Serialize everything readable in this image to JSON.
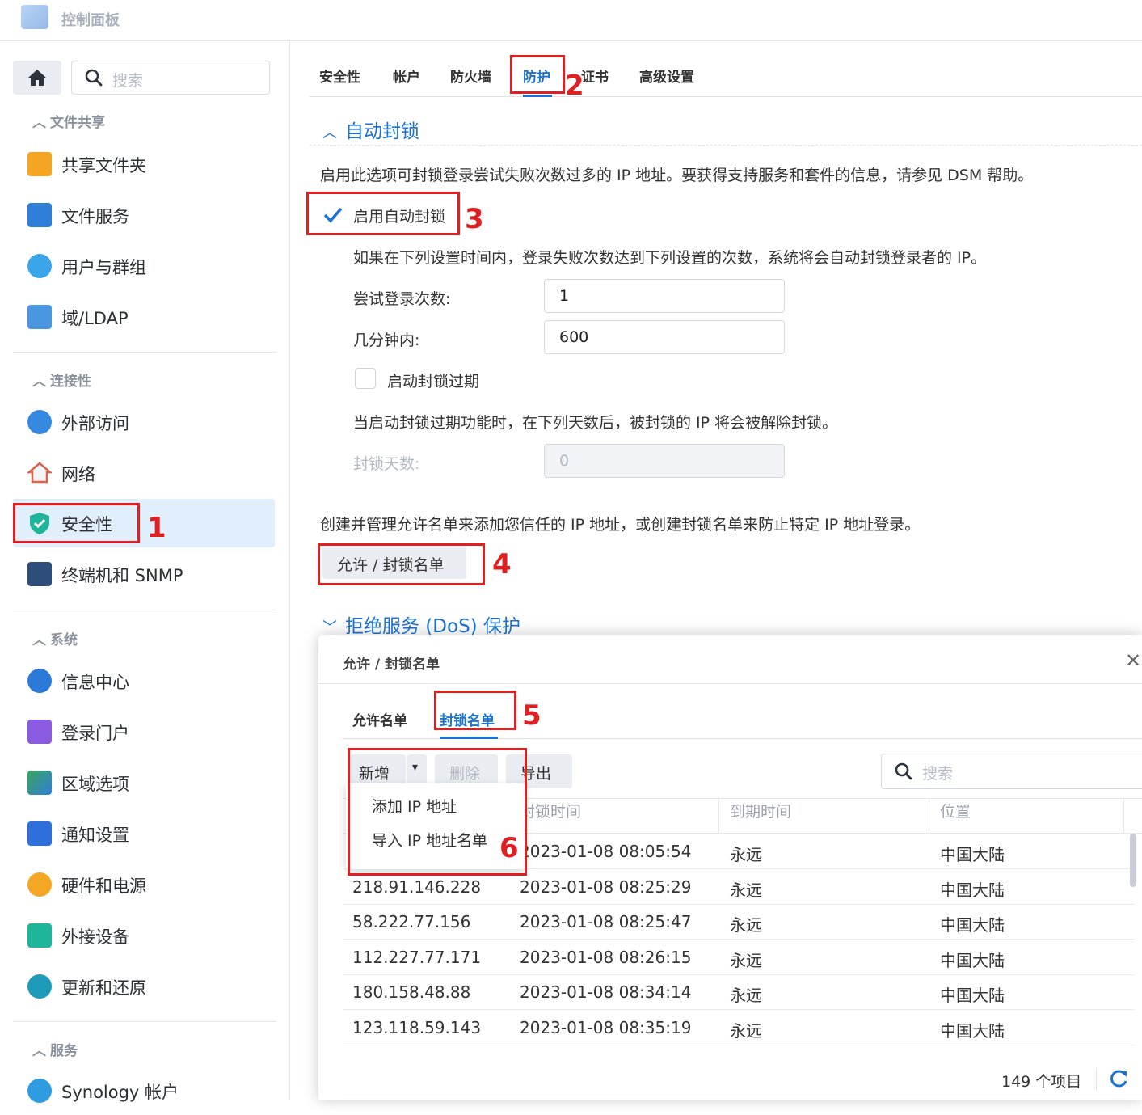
{
  "app": {
    "title": "控制面板"
  },
  "sidebar": {
    "search_placeholder": "搜索",
    "sections": [
      {
        "label": "文件共享",
        "items": [
          {
            "label": "共享文件夹",
            "icon": "shared-folder-icon"
          },
          {
            "label": "文件服务",
            "icon": "file-services-icon"
          },
          {
            "label": "用户与群组",
            "icon": "users-groups-icon"
          },
          {
            "label": "域/LDAP",
            "icon": "domain-ldap-icon"
          }
        ]
      },
      {
        "label": "连接性",
        "items": [
          {
            "label": "外部访问",
            "icon": "external-access-icon"
          },
          {
            "label": "网络",
            "icon": "network-icon"
          },
          {
            "label": "安全性",
            "icon": "security-shield-icon"
          },
          {
            "label": "终端机和 SNMP",
            "icon": "terminal-icon"
          }
        ]
      },
      {
        "label": "系统",
        "items": [
          {
            "label": "信息中心",
            "icon": "info-center-icon"
          },
          {
            "label": "登录门户",
            "icon": "login-portal-icon"
          },
          {
            "label": "区域选项",
            "icon": "regional-options-icon"
          },
          {
            "label": "通知设置",
            "icon": "notification-icon"
          },
          {
            "label": "硬件和电源",
            "icon": "hardware-power-icon"
          },
          {
            "label": "外接设备",
            "icon": "external-devices-icon"
          },
          {
            "label": "更新和还原",
            "icon": "update-restore-icon"
          }
        ]
      },
      {
        "label": "服务",
        "items": [
          {
            "label": "Synology 帐户",
            "icon": "synology-account-icon"
          }
        ]
      }
    ]
  },
  "tabs": [
    "安全性",
    "帐户",
    "防火墙",
    "防护",
    "证书",
    "高级设置"
  ],
  "autoblock": {
    "title": "自动封锁",
    "desc": "启用此选项可封锁登录尝试失败次数过多的 IP 地址。要获得支持服务和套件的信息，请参见 DSM 帮助。",
    "enable_label": "启用自动封锁",
    "rule_desc": "如果在下列设置时间内，登录失败次数达到下列设置的次数，系统将会自动封锁登录者的 IP。",
    "attempts_label": "尝试登录次数:",
    "attempts_value": "1",
    "minutes_label": "几分钟内:",
    "minutes_value": "600",
    "expire_label": "启动封锁过期",
    "expire_desc": "当启动封锁过期功能时，在下列天数后，被封锁的 IP 将会被解除封锁。",
    "days_label": "封锁天数:",
    "days_value": "0",
    "list_desc": "创建并管理允许名单来添加您信任的 IP 地址，或创建封锁名单来防止特定 IP 地址登录。",
    "list_button": "允许 / 封锁名单"
  },
  "dos": {
    "title": "拒绝服务 (DoS) 保护"
  },
  "dialog": {
    "title": "允许 / 封锁名单",
    "tabs": [
      "允许名单",
      "封锁名单"
    ],
    "toolbar": {
      "add": "新增",
      "delete": "删除",
      "export": "导出",
      "search_placeholder": "搜索"
    },
    "dropdown": [
      "添加 IP 地址",
      "导入 IP 地址名单"
    ],
    "columns": [
      "封锁时间",
      "到期时间",
      "位置"
    ],
    "rows": [
      {
        "ip": "",
        "time": "2023-01-08 08:05:54",
        "expire": "永远",
        "loc": "中国大陆"
      },
      {
        "ip": "218.91.146.228",
        "time": "2023-01-08 08:25:29",
        "expire": "永远",
        "loc": "中国大陆"
      },
      {
        "ip": "58.222.77.156",
        "time": "2023-01-08 08:25:47",
        "expire": "永远",
        "loc": "中国大陆"
      },
      {
        "ip": "112.227.77.171",
        "time": "2023-01-08 08:26:15",
        "expire": "永远",
        "loc": "中国大陆"
      },
      {
        "ip": "180.158.48.88",
        "time": "2023-01-08 08:34:14",
        "expire": "永远",
        "loc": "中国大陆"
      },
      {
        "ip": "123.118.59.143",
        "time": "2023-01-08 08:35:19",
        "expire": "永远",
        "loc": "中国大陆"
      }
    ],
    "count": "149 个项目"
  },
  "annotations": [
    "1",
    "2",
    "3",
    "4",
    "5",
    "6"
  ],
  "colors": {
    "accent": "#1a73d2",
    "annotation": "#e02020",
    "active_bg": "#e1eefb"
  }
}
